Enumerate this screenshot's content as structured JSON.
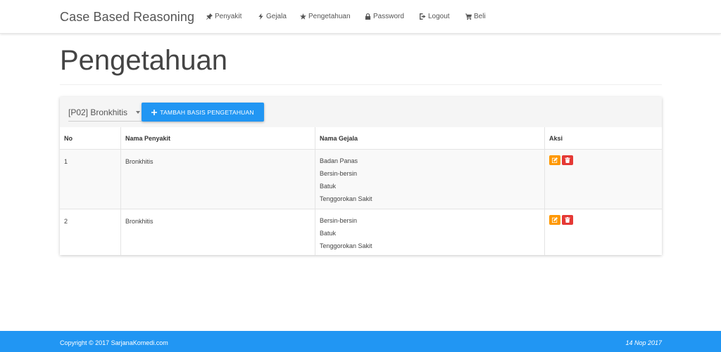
{
  "navbar": {
    "brand": "Case Based Reasoning",
    "items": [
      {
        "label": "Penyakit",
        "icon": "pin-icon"
      },
      {
        "label": "Gejala",
        "icon": "flash-icon"
      },
      {
        "label": "Pengetahuan",
        "icon": "star-icon"
      },
      {
        "label": "Password",
        "icon": "lock-icon"
      },
      {
        "label": "Logout",
        "icon": "logout-icon"
      },
      {
        "label": "Beli",
        "icon": "cart-icon"
      }
    ]
  },
  "page": {
    "title": "Pengetahuan"
  },
  "panel": {
    "select_value": "[P02] Bronkhitis",
    "add_button_label": "TAMBAH BASIS PENGETAHUAN"
  },
  "table": {
    "headers": {
      "no": "No",
      "penyakit": "Nama Penyakit",
      "gejala": "Nama Gejala",
      "aksi": "Aksi"
    },
    "rows": [
      {
        "no": "1",
        "penyakit": "Bronkhitis",
        "gejala": [
          "Badan Panas",
          "Bersin-bersin",
          "Batuk",
          "Tenggorokan Sakit"
        ]
      },
      {
        "no": "2",
        "penyakit": "Bronkhitis",
        "gejala": [
          "Bersin-bersin",
          "Batuk",
          "Tenggorokan Sakit"
        ]
      }
    ]
  },
  "footer": {
    "copyright": "Copyright © 2017 SarjanaKomedi.com",
    "date": "14 Nop 2017"
  },
  "colors": {
    "primary": "#2196f3",
    "edit": "#ff9800",
    "delete": "#e53935"
  }
}
